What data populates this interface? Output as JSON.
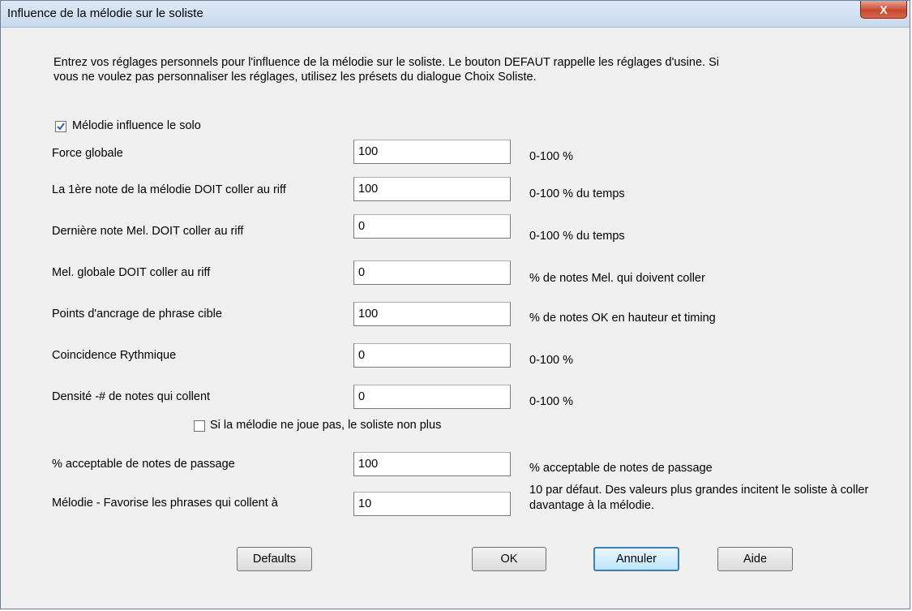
{
  "window": {
    "title": "Influence de la mélodie sur le soliste",
    "close_label": "X"
  },
  "info_text": "Entrez vos réglages personnels pour l'influence de la mélodie sur le soliste. Le bouton DEFAUT rappelle les réglages d'usine. Si vous ne voulez pas personnaliser les réglages, utilisez les présets du dialogue Choix Soliste.",
  "melody_checkbox": {
    "label": "Mélodie influence le solo",
    "checked": true
  },
  "fields": [
    {
      "label": "Force globale",
      "value": "100",
      "hint": "0-100 %"
    },
    {
      "label": "La 1ère note de la mélodie DOIT coller au riff",
      "value": "100",
      "hint": "0-100 % du temps"
    },
    {
      "label": "Dernière note Mel. DOIT coller au riff",
      "value": "0",
      "hint": "0-100 % du temps"
    },
    {
      "label": " Mel. globale DOIT coller au riff",
      "value": "0",
      "hint": "% de notes Mel. qui doivent coller"
    },
    {
      "label": "Points d'ancrage de phrase cible",
      "value": "100",
      "hint": "% de notes OK en hauteur et timing"
    },
    {
      "label": " Coincidence Rythmique",
      "value": "0",
      "hint": "0-100 %"
    },
    {
      "label": "Densité -# de notes qui collent",
      "value": "0",
      "hint": "0-100 %"
    },
    {
      "label": "% acceptable de notes de passage",
      "value": "100",
      "hint": "% acceptable de notes de passage"
    },
    {
      "label": "Mélodie - Favorise les phrases qui collent à",
      "value": "10",
      "hint": "10 par défaut. Des valeurs plus grandes incitent le soliste à coller davantage à la mélodie."
    }
  ],
  "silent_checkbox": {
    "label": "Si la mélodie ne joue pas, le soliste non plus",
    "checked": false
  },
  "buttons": {
    "defaults": "Defaults",
    "ok": "OK",
    "cancel": "Annuler",
    "help": "Aide"
  },
  "colors": {
    "title_bar": "#c9daee",
    "close_button": "#c7472e",
    "check_mark": "#2b5ea8"
  }
}
